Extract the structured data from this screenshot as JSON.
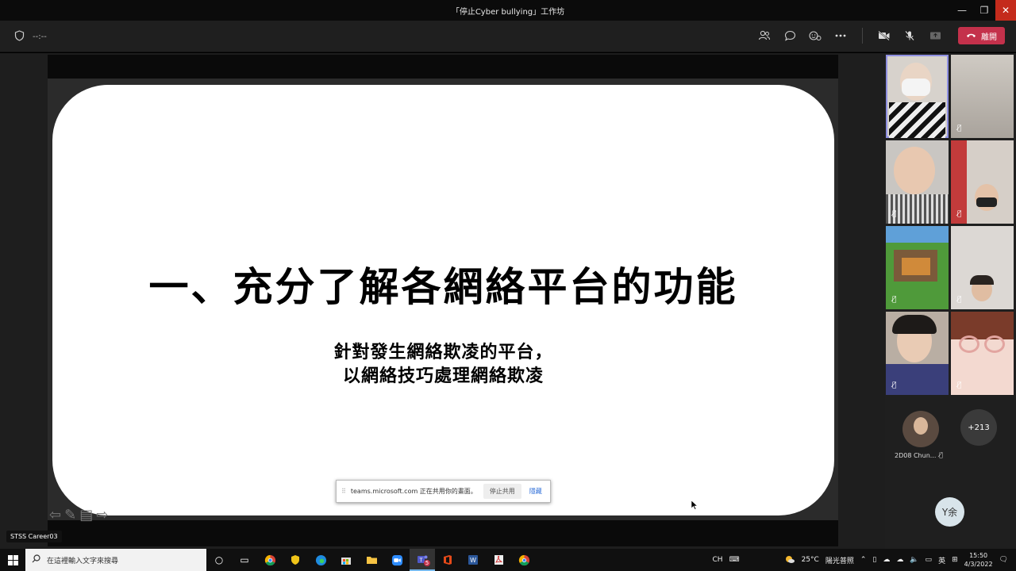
{
  "window": {
    "title": "「停止Cyber bullying」工作坊",
    "minimize": "—",
    "restore": "❐",
    "close": "✕"
  },
  "toolbar": {
    "timer": "--:--",
    "leave_label": "離開"
  },
  "slide": {
    "title": "一、充分了解各網絡平台的功能",
    "sub_line1": "針對發生網絡欺凌的平台，",
    "sub_line2": "以網絡技巧處理網絡欺凌"
  },
  "share_bar": {
    "message": "teams.microsoft.com 正在共用你的畫面。",
    "stop_label": "停止共用",
    "hide_label": "隱藏"
  },
  "presenter_label": "STSS Career03",
  "participants": {
    "named_user": "2D08 Chun...",
    "more_count": "+213",
    "self_initials": "Y余"
  },
  "taskbar": {
    "search_placeholder": "在這裡輸入文字來搜尋",
    "teams_badge": "5",
    "ime": "CH",
    "weather_temp": "25°C",
    "weather_text": "陽光普照",
    "lang": "英",
    "time": "15:50",
    "date": "4/3/2022"
  },
  "colors": {
    "leave": "#c4314b",
    "active_tile": "#8e8fe0",
    "close": "#c42b1c"
  }
}
